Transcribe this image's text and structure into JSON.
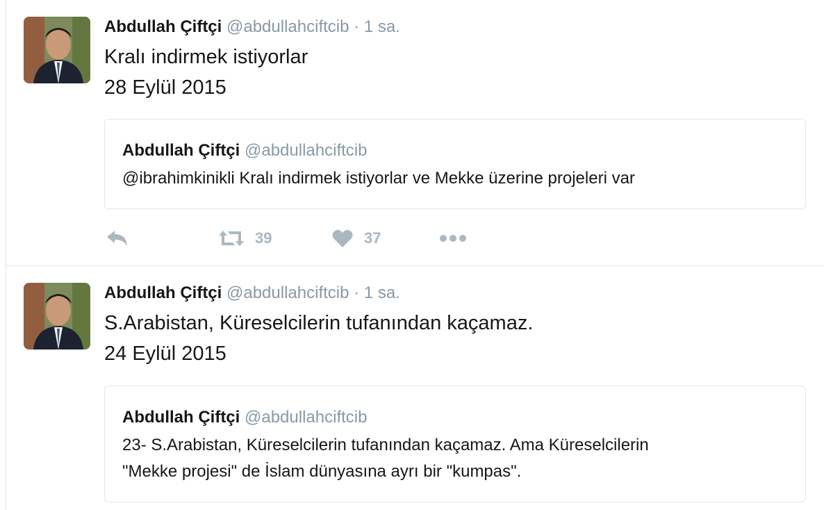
{
  "tweets": [
    {
      "author": {
        "name": "Abdullah Çiftçi",
        "handle": "@abdullahciftcib"
      },
      "separator": "·",
      "time": "1 sa.",
      "text_line1": "Kralı indirmek istiyorlar",
      "text_line2": "28 Eylül 2015",
      "quote": {
        "name": "Abdullah Çiftçi",
        "handle": "@abdullahciftcib",
        "text": "@ibrahimkinikli Kralı indirmek istiyorlar ve Mekke üzerine projeleri var"
      },
      "actions": {
        "retweets": "39",
        "likes": "37"
      }
    },
    {
      "author": {
        "name": "Abdullah Çiftçi",
        "handle": "@abdullahciftcib"
      },
      "separator": "·",
      "time": "1 sa.",
      "text_line1": "S.Arabistan, Küreselcilerin tufanından kaçamaz.",
      "text_line2": "24 Eylül 2015",
      "quote": {
        "name": "Abdullah Çiftçi",
        "handle": "@abdullahciftcib",
        "text_line1": "23- S.Arabistan, Küreselcilerin tufanından kaçamaz. Ama Küreselcilerin",
        "text_line2": "\"Mekke projesi\" de İslam dünyasına ayrı bir \"kumpas\"."
      }
    }
  ],
  "colors": {
    "text": "#14171a",
    "muted": "#8899a6",
    "icon": "#aab8c2",
    "border": "#e1e8ed"
  },
  "icons": [
    "reply-icon",
    "retweet-icon",
    "heart-icon",
    "more-icon"
  ]
}
